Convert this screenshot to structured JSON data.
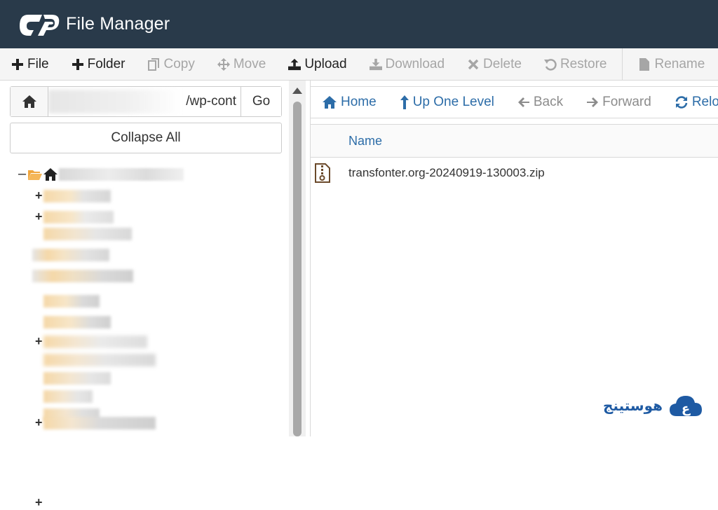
{
  "app": {
    "title": "File Manager"
  },
  "toolbar": {
    "file": "File",
    "folder": "Folder",
    "copy": "Copy",
    "move": "Move",
    "upload": "Upload",
    "download": "Download",
    "delete": "Delete",
    "restore": "Restore",
    "rename": "Rename"
  },
  "left": {
    "path_value": "/wp-cont",
    "go_label": "Go",
    "collapse_label": "Collapse All"
  },
  "nav": {
    "home": "Home",
    "up": "Up One Level",
    "back": "Back",
    "forward": "Forward",
    "reload": "Reloa"
  },
  "table": {
    "header_name": "Name",
    "files": [
      {
        "name": "transfonter.org-20240919-130003.zip",
        "icon": "zip-file-icon"
      }
    ]
  },
  "brand": {
    "text": "هوستينج"
  },
  "colors": {
    "header_bg": "#293a4a",
    "link_blue": "#2d6da8",
    "folder_orange": "#f0a63e",
    "disabled_grey": "#a6a6a6"
  }
}
